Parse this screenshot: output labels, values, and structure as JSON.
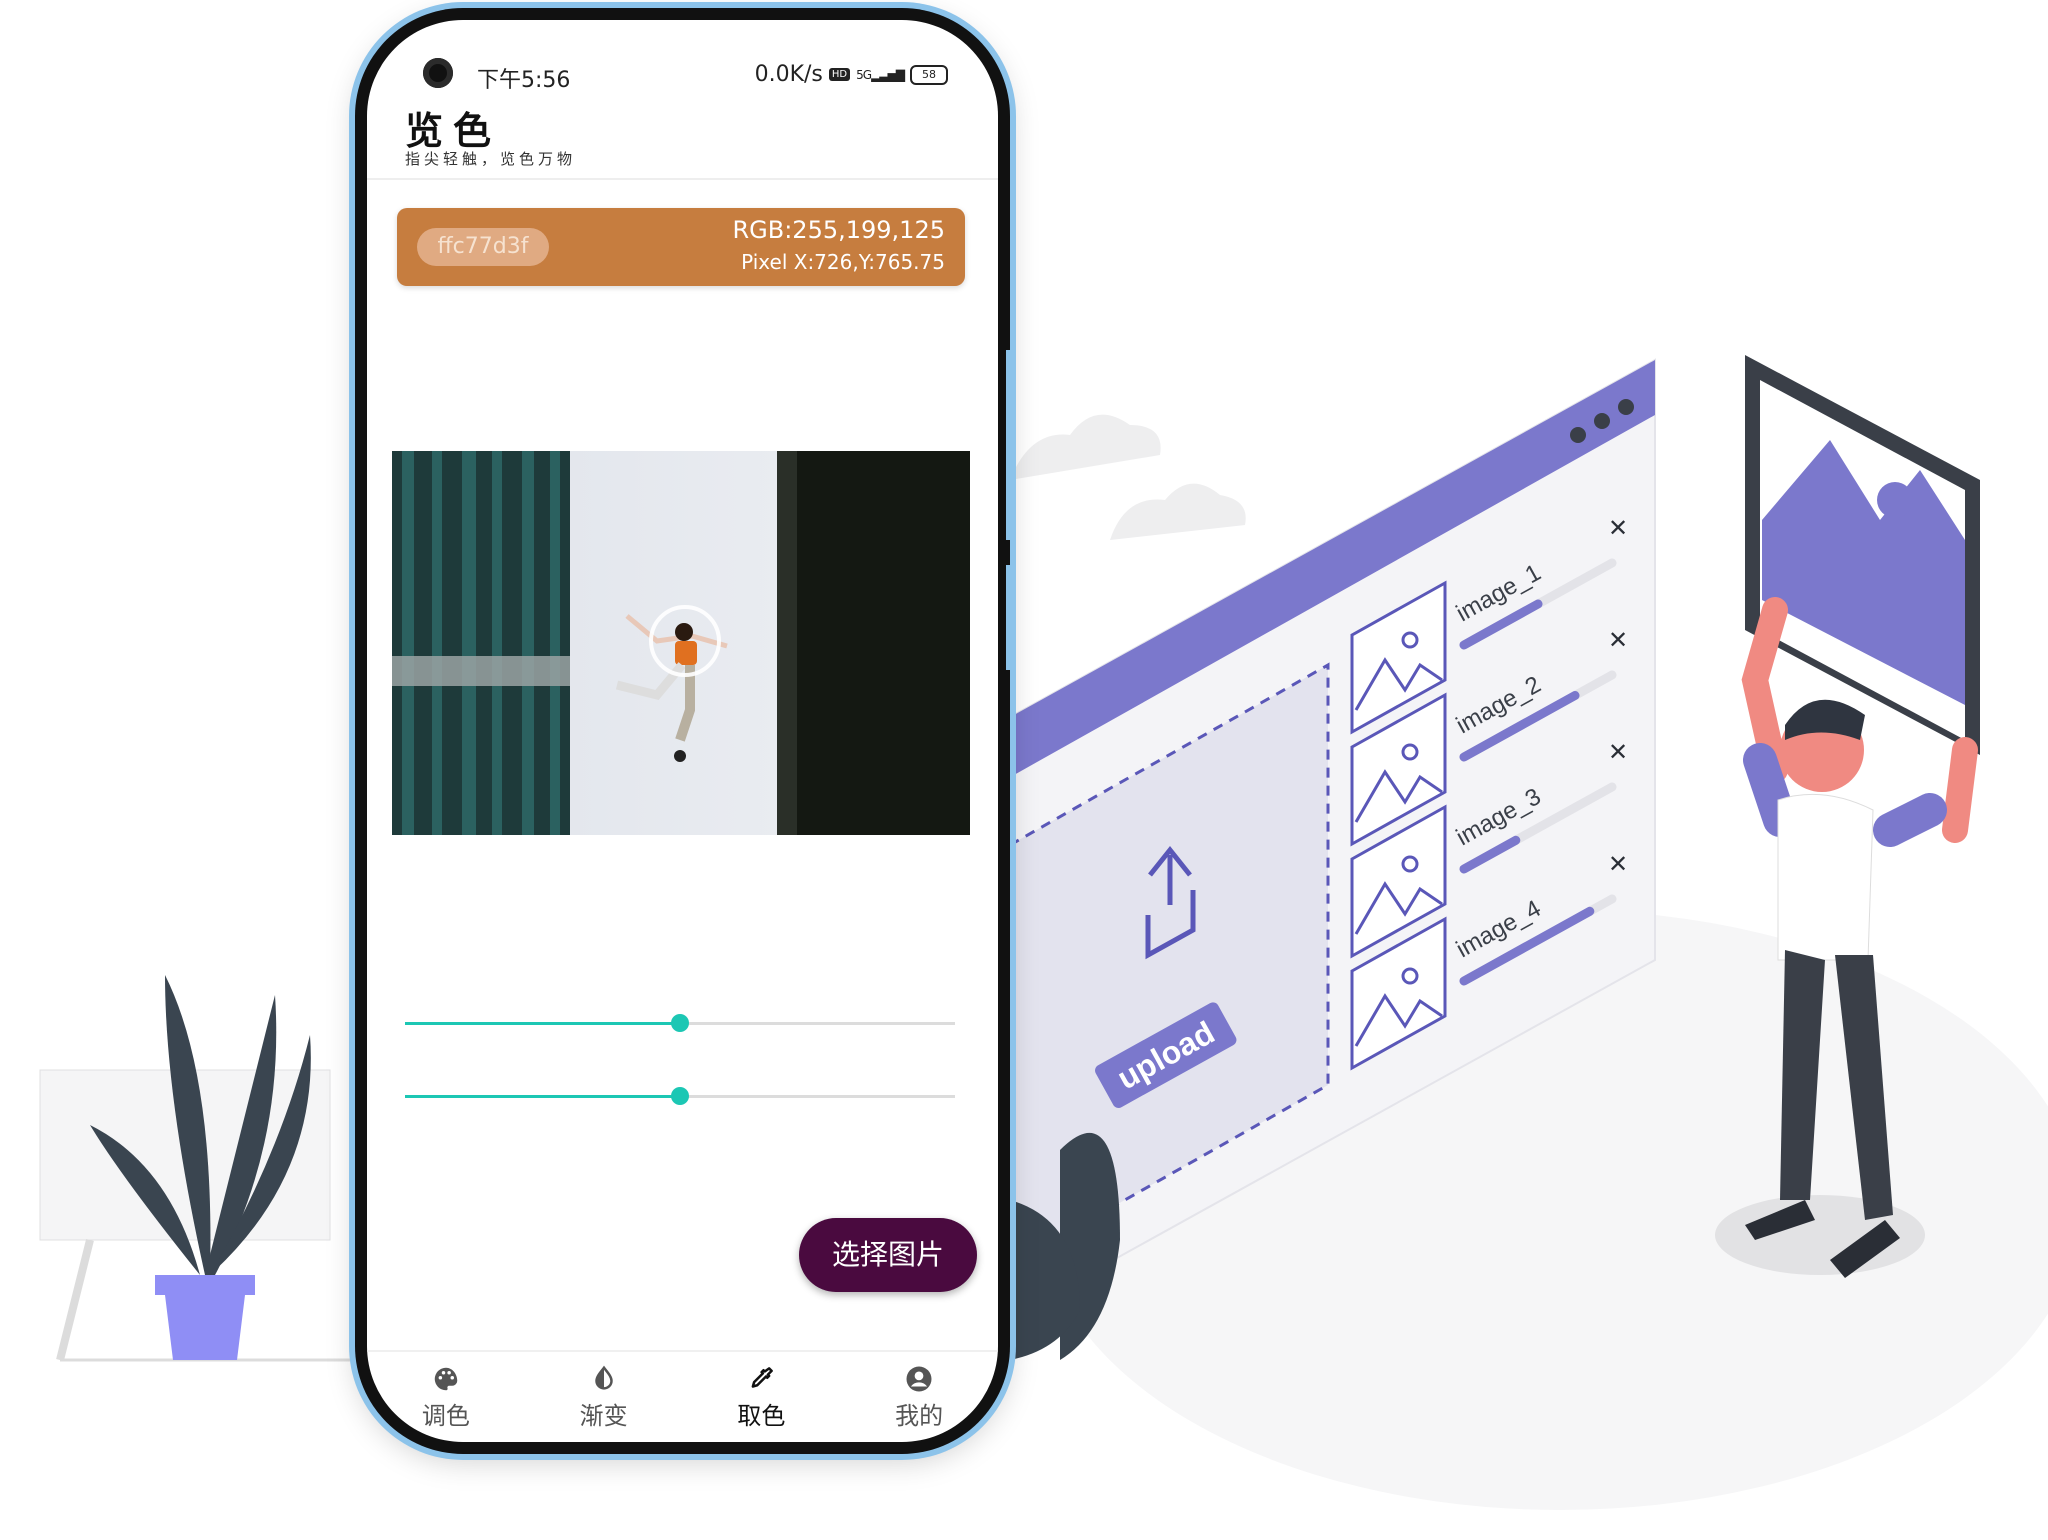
{
  "status_bar": {
    "time": "下午5:56",
    "net_speed": "0.0K/s",
    "hd": "HD",
    "signal": "5G",
    "battery": "58"
  },
  "app": {
    "title": "览色",
    "subtitle": "指尖轻触，览色万物"
  },
  "color_card": {
    "hex": "ffc77d3f",
    "rgb": "RGB:255,199,125",
    "pixel": "Pixel X:726,Y:765.75",
    "card_color": "#c67d3f"
  },
  "sliders": [
    {
      "value": 0.5
    },
    {
      "value": 0.5
    }
  ],
  "fab": {
    "label": "选择图片"
  },
  "nav": [
    {
      "label": "调色",
      "icon": "palette-icon"
    },
    {
      "label": "渐变",
      "icon": "contrast-icon"
    },
    {
      "label": "取色",
      "icon": "eyedropper-icon",
      "active": true
    },
    {
      "label": "我的",
      "icon": "account-icon"
    }
  ],
  "illustration": {
    "files": [
      "image_1",
      "image_2",
      "image_3",
      "image_4"
    ],
    "file_progress": [
      0.5,
      0.75,
      0.35,
      0.85
    ],
    "upload_label": "upload",
    "accent_color": "#7b78cc"
  }
}
